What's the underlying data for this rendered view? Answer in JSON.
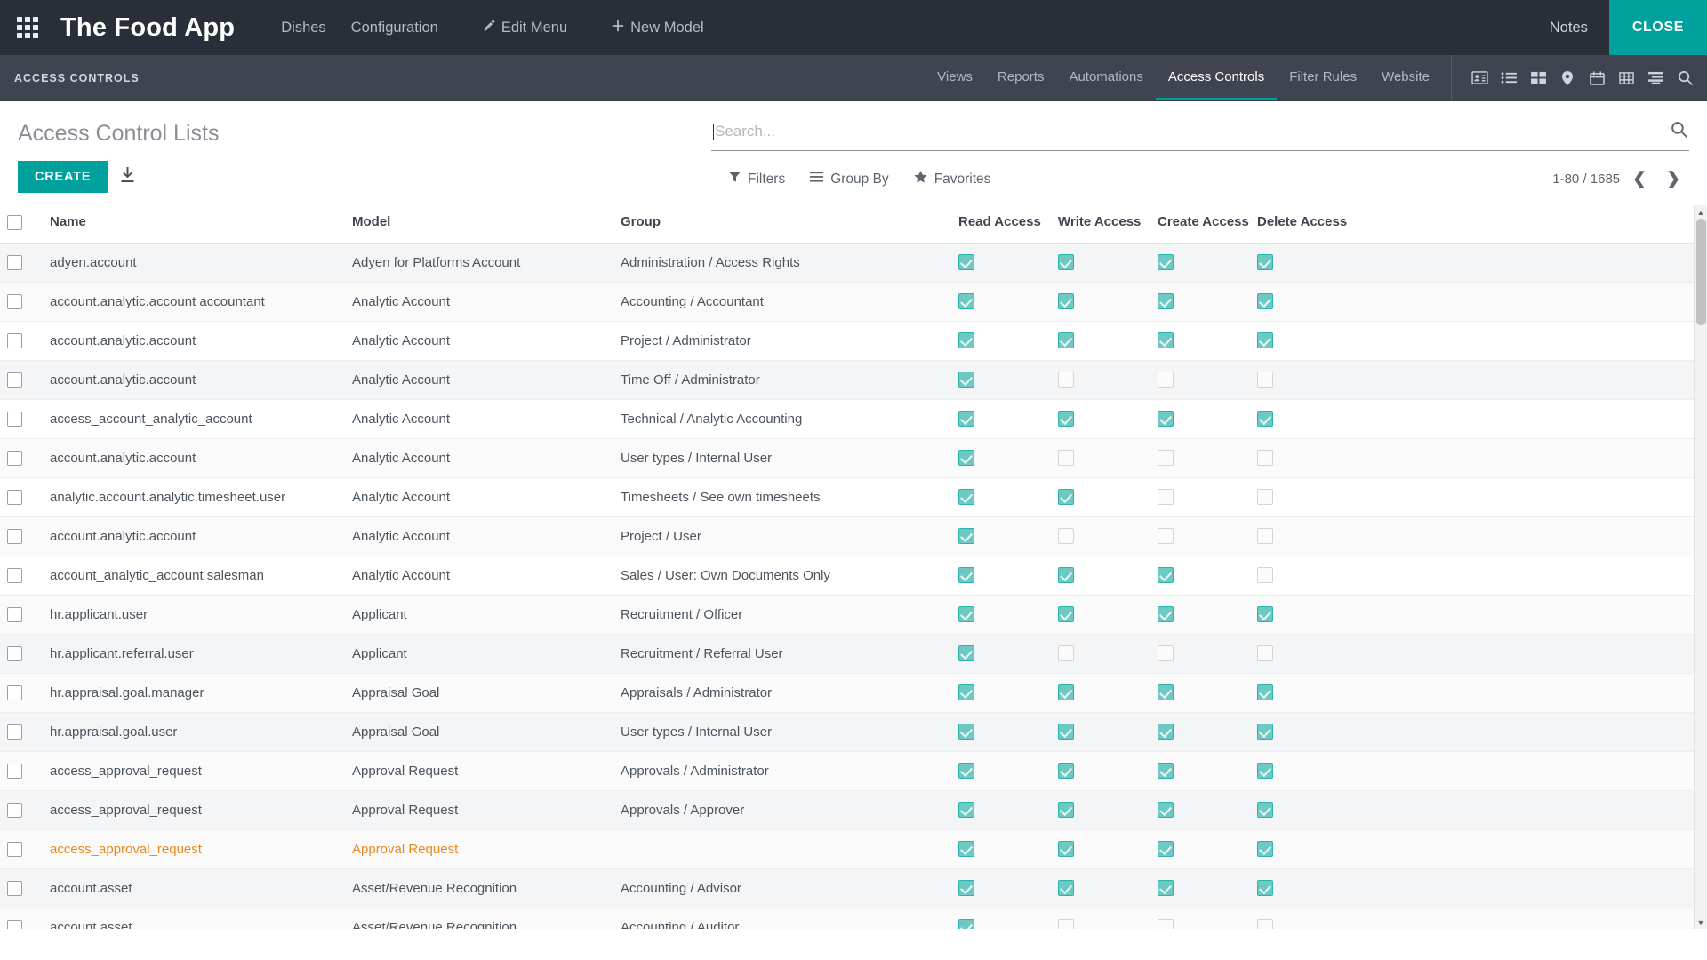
{
  "topbar": {
    "apps_icon": "apps-grid-icon",
    "brand": "The Food App",
    "menu": [
      {
        "label": "Dishes",
        "icon": null
      },
      {
        "label": "Configuration",
        "icon": null
      },
      {
        "label": "Edit Menu",
        "icon": "pencil-icon"
      },
      {
        "label": "New Model",
        "icon": "plus-icon"
      }
    ],
    "notes_label": "Notes",
    "close_label": "CLOSE",
    "close_color": "#00A09D"
  },
  "subbar": {
    "title": "ACCESS CONTROLS",
    "tabs": [
      {
        "label": "Views",
        "active": false
      },
      {
        "label": "Reports",
        "active": false
      },
      {
        "label": "Automations",
        "active": false
      },
      {
        "label": "Access Controls",
        "active": true
      },
      {
        "label": "Filter Rules",
        "active": false
      },
      {
        "label": "Website",
        "active": false
      }
    ],
    "view_icons": [
      "contact-card-icon",
      "list-view-icon",
      "kanban-view-icon",
      "map-pin-icon",
      "calendar-icon",
      "pivot-table-icon",
      "gantt-icon",
      "search-icon"
    ]
  },
  "page": {
    "title": "Access Control Lists",
    "create_label": "CREATE",
    "download_icon": "download-icon"
  },
  "search": {
    "placeholder": "Search...",
    "value": "",
    "icon": "search-icon"
  },
  "controls": {
    "filters_label": "Filters",
    "groupby_label": "Group By",
    "favorites_label": "Favorites",
    "filters_icon": "funnel-icon",
    "groupby_icon": "hamburger-icon",
    "favorites_icon": "star-icon",
    "pager_text": "1-80 / 1685",
    "prev_icon": "chevron-left-icon",
    "next_icon": "chevron-right-icon"
  },
  "table": {
    "columns": [
      "Name",
      "Model",
      "Group",
      "Read Access",
      "Write Access",
      "Create Access",
      "Delete Access"
    ],
    "rows": [
      {
        "name": "adyen.account",
        "model": "Adyen for Platforms Account",
        "group": "Administration / Access Rights",
        "read": true,
        "write": true,
        "create": true,
        "delete": true,
        "highlight": false,
        "shade": true
      },
      {
        "name": "account.analytic.account accountant",
        "model": "Analytic Account",
        "group": "Accounting / Accountant",
        "read": true,
        "write": true,
        "create": true,
        "delete": true,
        "highlight": false,
        "shade": false
      },
      {
        "name": "account.analytic.account",
        "model": "Analytic Account",
        "group": "Project / Administrator",
        "read": true,
        "write": true,
        "create": true,
        "delete": true,
        "highlight": false,
        "shade": false
      },
      {
        "name": "account.analytic.account",
        "model": "Analytic Account",
        "group": "Time Off / Administrator",
        "read": true,
        "write": false,
        "create": false,
        "delete": false,
        "highlight": false,
        "shade": true
      },
      {
        "name": "access_account_analytic_account",
        "model": "Analytic Account",
        "group": "Technical / Analytic Accounting",
        "read": true,
        "write": true,
        "create": true,
        "delete": true,
        "highlight": false,
        "shade": false
      },
      {
        "name": "account.analytic.account",
        "model": "Analytic Account",
        "group": "User types / Internal User",
        "read": true,
        "write": false,
        "create": false,
        "delete": false,
        "highlight": false,
        "shade": false
      },
      {
        "name": "analytic.account.analytic.timesheet.user",
        "model": "Analytic Account",
        "group": "Timesheets / See own timesheets",
        "read": true,
        "write": true,
        "create": false,
        "delete": false,
        "highlight": false,
        "shade": false
      },
      {
        "name": "account.analytic.account",
        "model": "Analytic Account",
        "group": "Project / User",
        "read": true,
        "write": false,
        "create": false,
        "delete": false,
        "highlight": false,
        "shade": false
      },
      {
        "name": "account_analytic_account salesman",
        "model": "Analytic Account",
        "group": "Sales / User: Own Documents Only",
        "read": true,
        "write": true,
        "create": true,
        "delete": false,
        "highlight": false,
        "shade": false
      },
      {
        "name": "hr.applicant.user",
        "model": "Applicant",
        "group": "Recruitment / Officer",
        "read": true,
        "write": true,
        "create": true,
        "delete": true,
        "highlight": false,
        "shade": false
      },
      {
        "name": "hr.applicant.referral.user",
        "model": "Applicant",
        "group": "Recruitment / Referral User",
        "read": true,
        "write": false,
        "create": false,
        "delete": false,
        "highlight": false,
        "shade": true
      },
      {
        "name": "hr.appraisal.goal.manager",
        "model": "Appraisal Goal",
        "group": "Appraisals / Administrator",
        "read": true,
        "write": true,
        "create": true,
        "delete": true,
        "highlight": false,
        "shade": false
      },
      {
        "name": "hr.appraisal.goal.user",
        "model": "Appraisal Goal",
        "group": "User types / Internal User",
        "read": true,
        "write": true,
        "create": true,
        "delete": true,
        "highlight": false,
        "shade": true
      },
      {
        "name": "access_approval_request",
        "model": "Approval Request",
        "group": "Approvals / Administrator",
        "read": true,
        "write": true,
        "create": true,
        "delete": true,
        "highlight": false,
        "shade": false
      },
      {
        "name": "access_approval_request",
        "model": "Approval Request",
        "group": "Approvals / Approver",
        "read": true,
        "write": true,
        "create": true,
        "delete": true,
        "highlight": false,
        "shade": true
      },
      {
        "name": "access_approval_request",
        "model": "Approval Request",
        "group": "",
        "read": true,
        "write": true,
        "create": true,
        "delete": true,
        "highlight": true,
        "shade": false
      },
      {
        "name": "account.asset",
        "model": "Asset/Revenue Recognition",
        "group": "Accounting / Advisor",
        "read": true,
        "write": true,
        "create": true,
        "delete": true,
        "highlight": false,
        "shade": true
      },
      {
        "name": "account.asset",
        "model": "Asset/Revenue Recognition",
        "group": "Accounting / Auditor",
        "read": true,
        "write": false,
        "create": false,
        "delete": false,
        "highlight": false,
        "shade": false
      }
    ]
  }
}
